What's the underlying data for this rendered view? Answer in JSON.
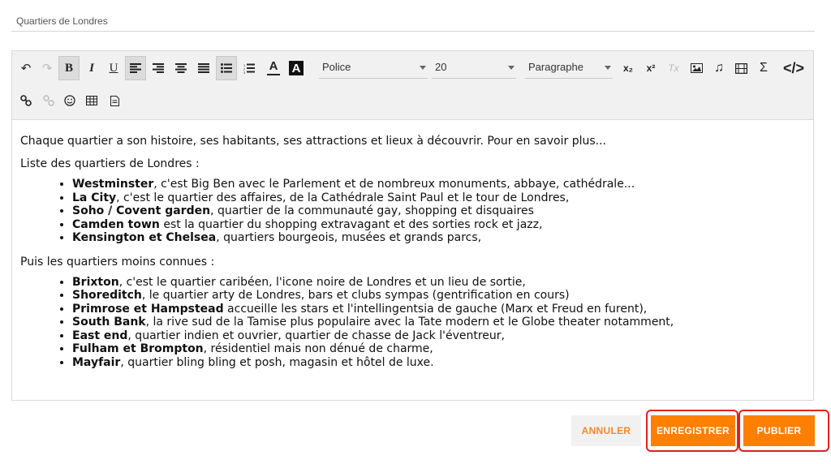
{
  "title_field": {
    "value": "Quartiers de Londres"
  },
  "toolbar": {
    "undo_icon": "↶",
    "redo_icon": "↷",
    "bold": "B",
    "italic": "I",
    "underline": "U",
    "font_color": "A",
    "font_bg": "A",
    "font_select": "Police",
    "size_select": "20",
    "format_select": "Paragraphe",
    "subscript": "x₂",
    "superscript": "x²",
    "clear_format": "Tx",
    "sigma": "Σ",
    "code": "</>"
  },
  "content": {
    "intro": "Chaque quartier a son histoire, ses habitants, ses attractions et lieux à découvrir. Pour en savoir plus...",
    "list1_heading": "Liste des quartiers de Londres :",
    "list1": [
      {
        "name": "Westminster",
        "desc": ", c'est Big Ben avec le Parlement et de nombreux monuments, abbaye, cathédrale..."
      },
      {
        "name": "La City",
        "desc": ", c'est le quartier des affaires, de la Cathédrale Saint Paul et le tour de Londres,"
      },
      {
        "name": "Soho / Covent garden",
        "desc": ", quartier de la communauté gay, shopping et disquaires"
      },
      {
        "name": "Camden town",
        "desc": " est la quartier du shopping extravagant et des sorties rock et jazz,"
      },
      {
        "name": "Kensington et Chelsea",
        "desc": ", quartiers bourgeois, musées et grands parcs,"
      }
    ],
    "list2_heading": "Puis les quartiers moins connues :",
    "list2": [
      {
        "name": "Brixton",
        "desc": ", c'est le quartier caribéen, l'icone noire de Londres et un lieu de sortie,"
      },
      {
        "name": "Shoreditch",
        "desc": ", le quartier arty de Londres, bars et clubs sympas (gentrification en cours)"
      },
      {
        "name": "Primrose et Hampstead",
        "desc": " accueille les stars et l'intellingentsia de gauche (Marx et Freud en furent),"
      },
      {
        "name": "South Bank",
        "desc": ", la rive sud de la Tamise plus populaire avec la Tate modern et le Globe theater notamment,"
      },
      {
        "name": "East end",
        "desc": ", quartier indien et ouvrier, quartier de chasse de Jack l'éventreur,"
      },
      {
        "name": "Fulham et Brompton",
        "desc": ", résidentiel mais non dénué de charme,"
      },
      {
        "name": "Mayfair",
        "desc": ", quartier bling bling et posh, magasin et hôtel de luxe."
      }
    ]
  },
  "actions": {
    "cancel": "ANNULER",
    "save": "ENREGISTRER",
    "publish": "PUBLIER"
  },
  "colors": {
    "accent": "#ff7f00",
    "highlight": "#e02020",
    "toolbar_bg": "#f1f1f1"
  }
}
